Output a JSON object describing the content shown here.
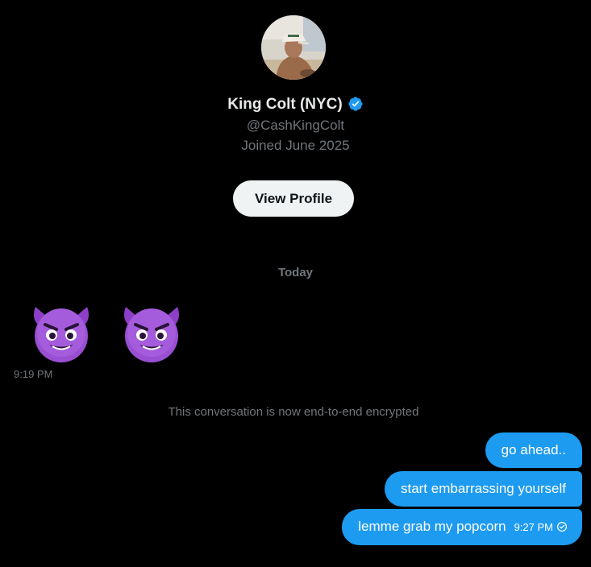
{
  "profile": {
    "display_name": "King Colt (NYC)",
    "handle": "@CashKingColt",
    "joined": "Joined June 2025",
    "view_profile_label": "View Profile",
    "verified_icon": "verified-badge-icon",
    "verified_color": "#1d9bf0"
  },
  "conversation": {
    "day_divider": "Today",
    "received": {
      "content": [
        "smiling-face-with-horns-emoji",
        "smiling-face-with-horns-emoji"
      ],
      "time": "9:19 PM"
    },
    "system_notice": "This conversation is now end-to-end encrypted",
    "sent": [
      {
        "text": "go ahead.."
      },
      {
        "text": "start embarrassing yourself"
      },
      {
        "text": "lemme grab my popcorn",
        "time": "9:27 PM",
        "status_icon": "sent-check-icon"
      }
    ]
  },
  "colors": {
    "background": "#000000",
    "primary_text": "#e7e9ea",
    "secondary_text": "#71767b",
    "sent_bubble": "#1d9bf0",
    "button_bg": "#eff3f4",
    "emoji_purple": "#9a4fd3"
  }
}
